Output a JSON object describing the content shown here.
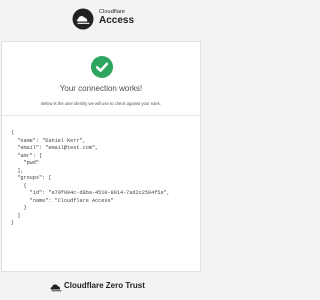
{
  "header": {
    "brand": "Cloudflare",
    "product": "Access"
  },
  "card": {
    "heading": "Your connection works!",
    "subheading": "Below is the user identity we will use to check against your rules.",
    "identity_json": "{\n  \"name\": \"Daniel Kerr\",\n  \"email\": \"email@test.com\",\n  \"amr\": [\n    \"pwd\"\n  ],\n  \"groups\": [\n    {\n      \"id\": \"e79f994c-d8ba-4510-8014-7ad2c2584f5a\",\n      \"name\": \"Cloudflare Access\"\n    }\n  ]\n}"
  },
  "footer": {
    "text": "Cloudflare Zero Trust"
  },
  "colors": {
    "accent_green": "#2ea55e",
    "background": "#f3f3f3"
  },
  "icons": {
    "header_logo": "cloudflare-access-logo-icon",
    "success": "checkmark-circle-icon",
    "footer_logo": "cloudflare-logo-icon"
  }
}
